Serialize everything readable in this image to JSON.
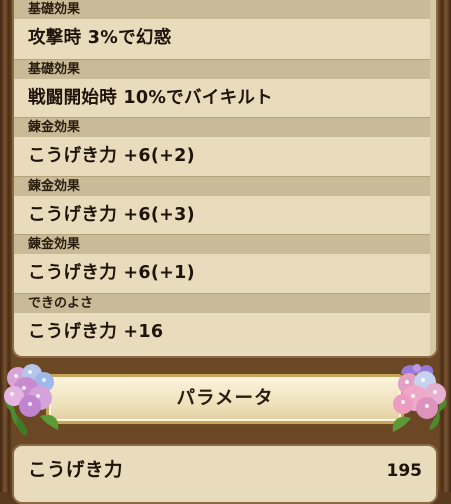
{
  "effects": [
    {
      "label": "基礎効果",
      "value": "攻撃時 3%で幻惑"
    },
    {
      "label": "基礎効果",
      "value": "戦闘開始時 10%でバイキルト"
    },
    {
      "label": "錬金効果",
      "value": "こうげき力 +6(+2)"
    },
    {
      "label": "錬金効果",
      "value": "こうげき力 +6(+3)"
    },
    {
      "label": "錬金効果",
      "value": "こうげき力 +6(+1)"
    },
    {
      "label": "できのよさ",
      "value": "こうげき力 +16"
    }
  ],
  "section": {
    "title": "パラメータ"
  },
  "params": [
    {
      "label": "こうげき力",
      "value": "195"
    }
  ],
  "icons": {
    "left": "hydrangea-flower-icon",
    "right": "hydrangea-slime-icon"
  },
  "colors": {
    "panel": "#e8dcbc",
    "header": "#c9bb98",
    "frame": "#6b4726",
    "banner_border": "#c9a55c"
  }
}
